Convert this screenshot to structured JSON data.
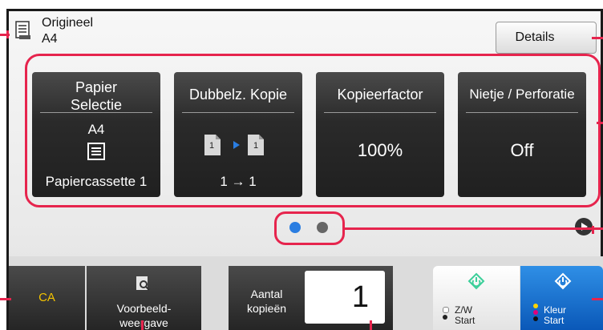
{
  "original": {
    "title": "Origineel",
    "size": "A4",
    "icon": "original-document-icon",
    "details_label": "Details"
  },
  "cards": [
    {
      "title": "Papier\nSelectie",
      "value": "A4",
      "icon": "paper-tray-icon",
      "sub": "Papiercassette 1"
    },
    {
      "title": "Dubbelz. Kopie",
      "icon": "duplex-copy-icon",
      "sub": "1 → 1"
    },
    {
      "title": "Kopieerfactor",
      "value": "100%"
    },
    {
      "title": "Nietje / Perforatie",
      "value": "Off"
    }
  ],
  "pager": {
    "active_page": 1,
    "pages": 2,
    "next_icon": "next-page-icon"
  },
  "bottom": {
    "ca_label": "CA",
    "preview_label": "Voorbeeld-\nweergave",
    "preview_icon": "preview-magnifier-icon",
    "copies_label": "Aantal\nkopieën",
    "copies_value": "1",
    "bw_start_label": "Z/W\nStart",
    "color_start_label": "Kleur\nStart",
    "start_icon": "start-diamond-icon"
  },
  "colors": {
    "accent_callout": "#e6244d",
    "ca_text": "#f3c300",
    "color_start": "#1a73d4",
    "pager_active": "#2a7de1",
    "pager_inactive": "#666666"
  }
}
